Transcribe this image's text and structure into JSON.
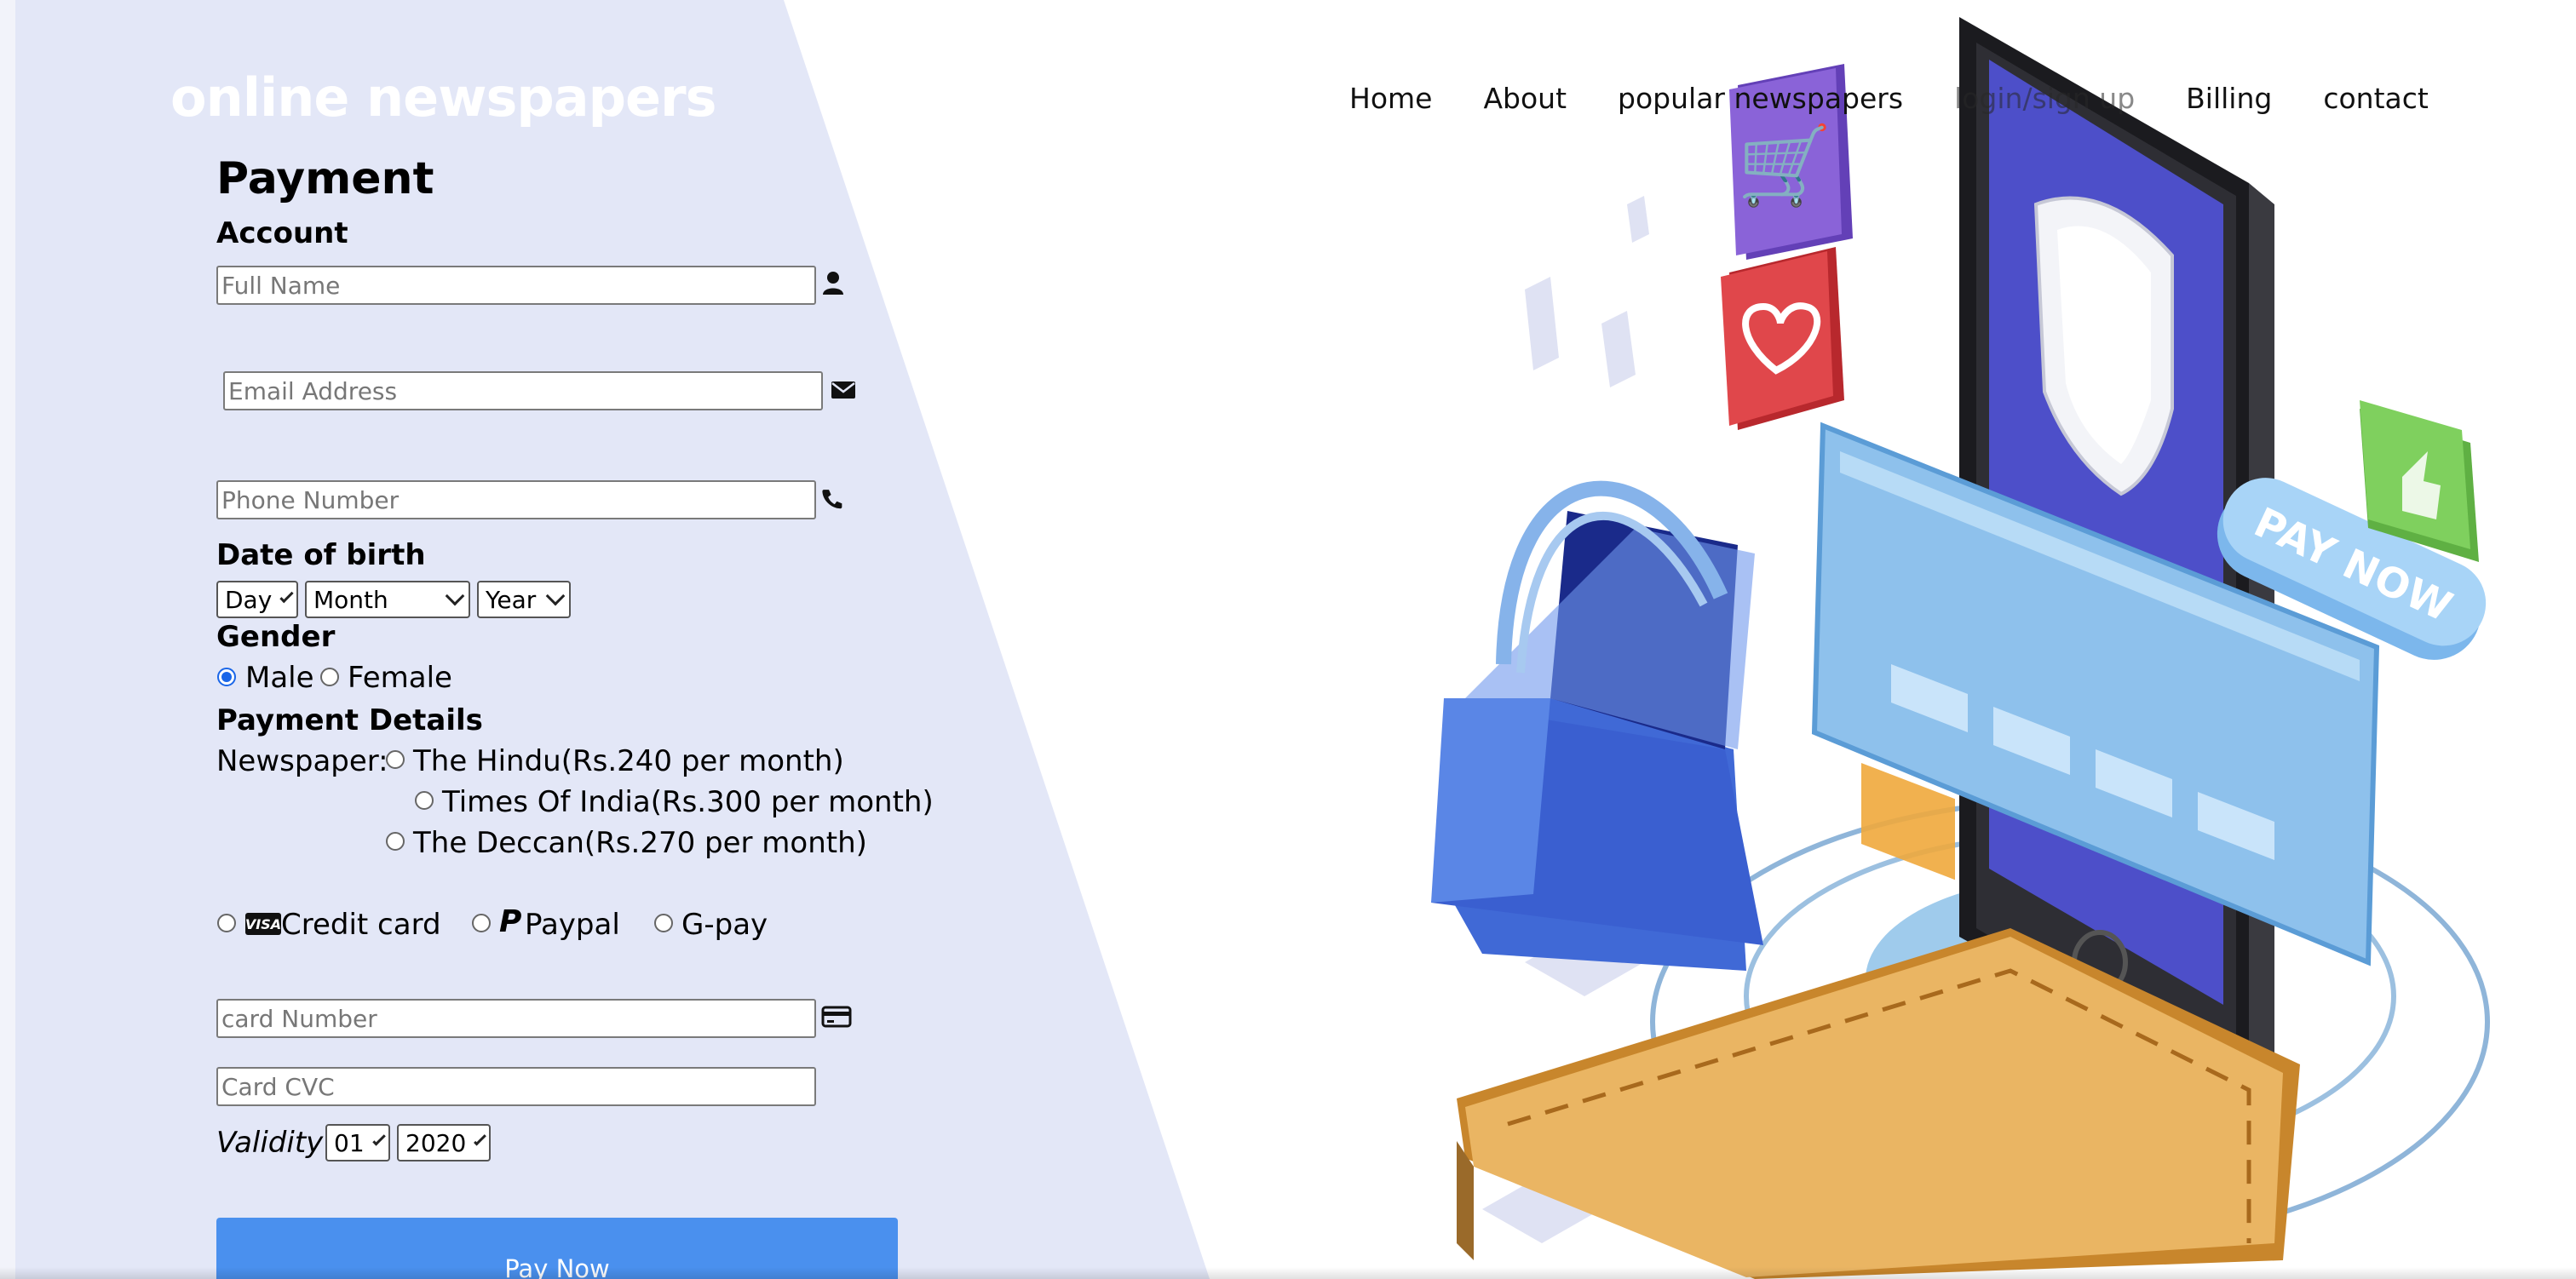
{
  "brand": {
    "name": "online newspapers"
  },
  "nav": {
    "items": [
      {
        "label": "Home"
      },
      {
        "label": "About"
      },
      {
        "label": "popular newspapers"
      },
      {
        "label": "login/sign up"
      },
      {
        "label": "Billing"
      },
      {
        "label": "contact"
      }
    ]
  },
  "form": {
    "title": "Payment",
    "account_heading": "Account",
    "full_name": {
      "placeholder": "Full Name",
      "value": ""
    },
    "email": {
      "placeholder": "Email Address",
      "value": ""
    },
    "phone": {
      "placeholder": "Phone Number",
      "value": ""
    },
    "dob_heading": "Date of birth",
    "dob": {
      "day": "Day",
      "month": "Month",
      "year": "Year"
    },
    "gender_heading": "Gender",
    "gender": {
      "male": "Male",
      "female": "Female",
      "selected": "Male"
    },
    "payment_details_heading": "Payment Details",
    "newspaper_label": "Newspaper:",
    "newspapers": [
      "The Hindu(Rs.240 per month)",
      "Times Of India(Rs.300 per month)",
      "The Deccan(Rs.270 per month)"
    ],
    "methods": {
      "credit_card": "Credit card",
      "visa_mark": "VISA",
      "paypal": "Paypal",
      "gpay": "G-pay"
    },
    "card_number": {
      "placeholder": "card Number",
      "value": ""
    },
    "card_cvc": {
      "placeholder": "Card CVC",
      "value": ""
    },
    "validity_label": "Validity",
    "validity_month": "01",
    "validity_year": "2020",
    "submit_label": "Pay Now"
  },
  "illustration": {
    "pay_now_badge": "PAY NOW"
  },
  "colors": {
    "panel": "#e3e7f7",
    "button": "#4a90ee",
    "radio_checked": "#1a66e8"
  }
}
